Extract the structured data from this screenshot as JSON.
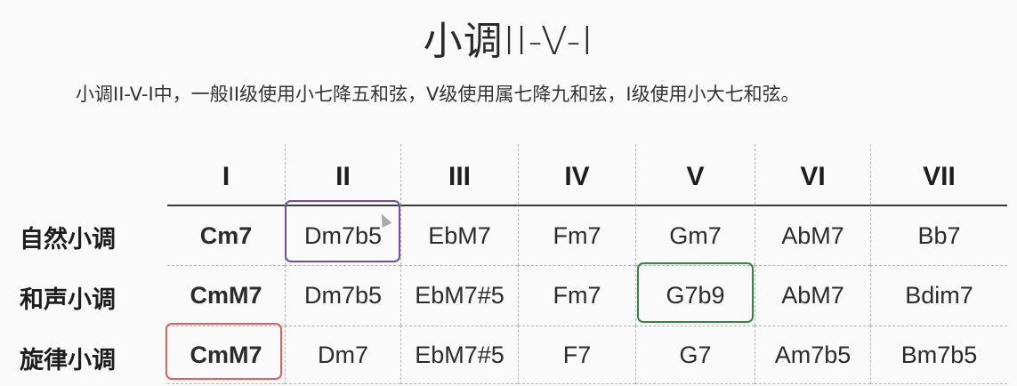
{
  "title": "小调II-V-I",
  "subtitle": "小调II-V-I中，一般II级使用小七降五和弦，V级使用属七降九和弦，I级使用小大七和弦。",
  "table": {
    "headers": [
      "I",
      "II",
      "III",
      "IV",
      "V",
      "VI",
      "VII"
    ],
    "rows": [
      {
        "label": "自然小调",
        "cells": [
          "Cm7",
          "Dm7b5",
          "EbM7",
          "Fm7",
          "Gm7",
          "AbM7",
          "Bb7"
        ]
      },
      {
        "label": "和声小调",
        "cells": [
          "CmM7",
          "Dm7b5",
          "EbM7#5",
          "Fm7",
          "G7b9",
          "AbM7",
          "Bdim7"
        ]
      },
      {
        "label": "旋律小调",
        "cells": [
          "CmM7",
          "Dm7",
          "EbM7#5",
          "F7",
          "G7",
          "Am7b5",
          "Bm7b5"
        ]
      }
    ]
  },
  "highlights": {
    "purple": "#6a4fa3",
    "green": "#2f8a3e",
    "red": "#d0675a"
  }
}
